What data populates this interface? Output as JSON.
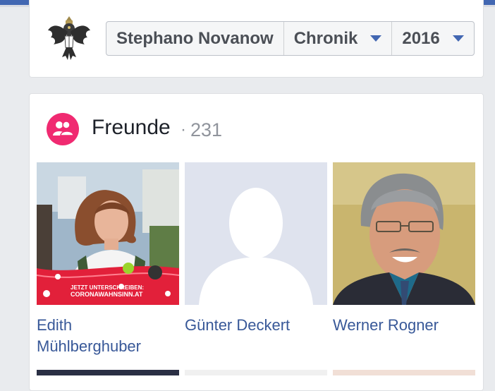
{
  "profile": {
    "name": "Stephano Novanow"
  },
  "nav": {
    "section": "Chronik",
    "year": "2016"
  },
  "friends": {
    "title": "Freunde",
    "separator": "·",
    "count": "231",
    "people": [
      {
        "name": "Edith Mühlberghuber",
        "badge_line1": "JETZT UNTERSCHREIBEN:",
        "badge_line2": "CORONAWAHNSINN.AT"
      },
      {
        "name": "Günter Deckert"
      },
      {
        "name": "Werner Rogner"
      }
    ]
  },
  "colors": {
    "brand_blue": "#4267b2",
    "link_blue": "#385898",
    "friends_pink": "#f02a71"
  },
  "icons": {
    "friends": "friends-icon",
    "logo": "eagle-crest-icon"
  }
}
